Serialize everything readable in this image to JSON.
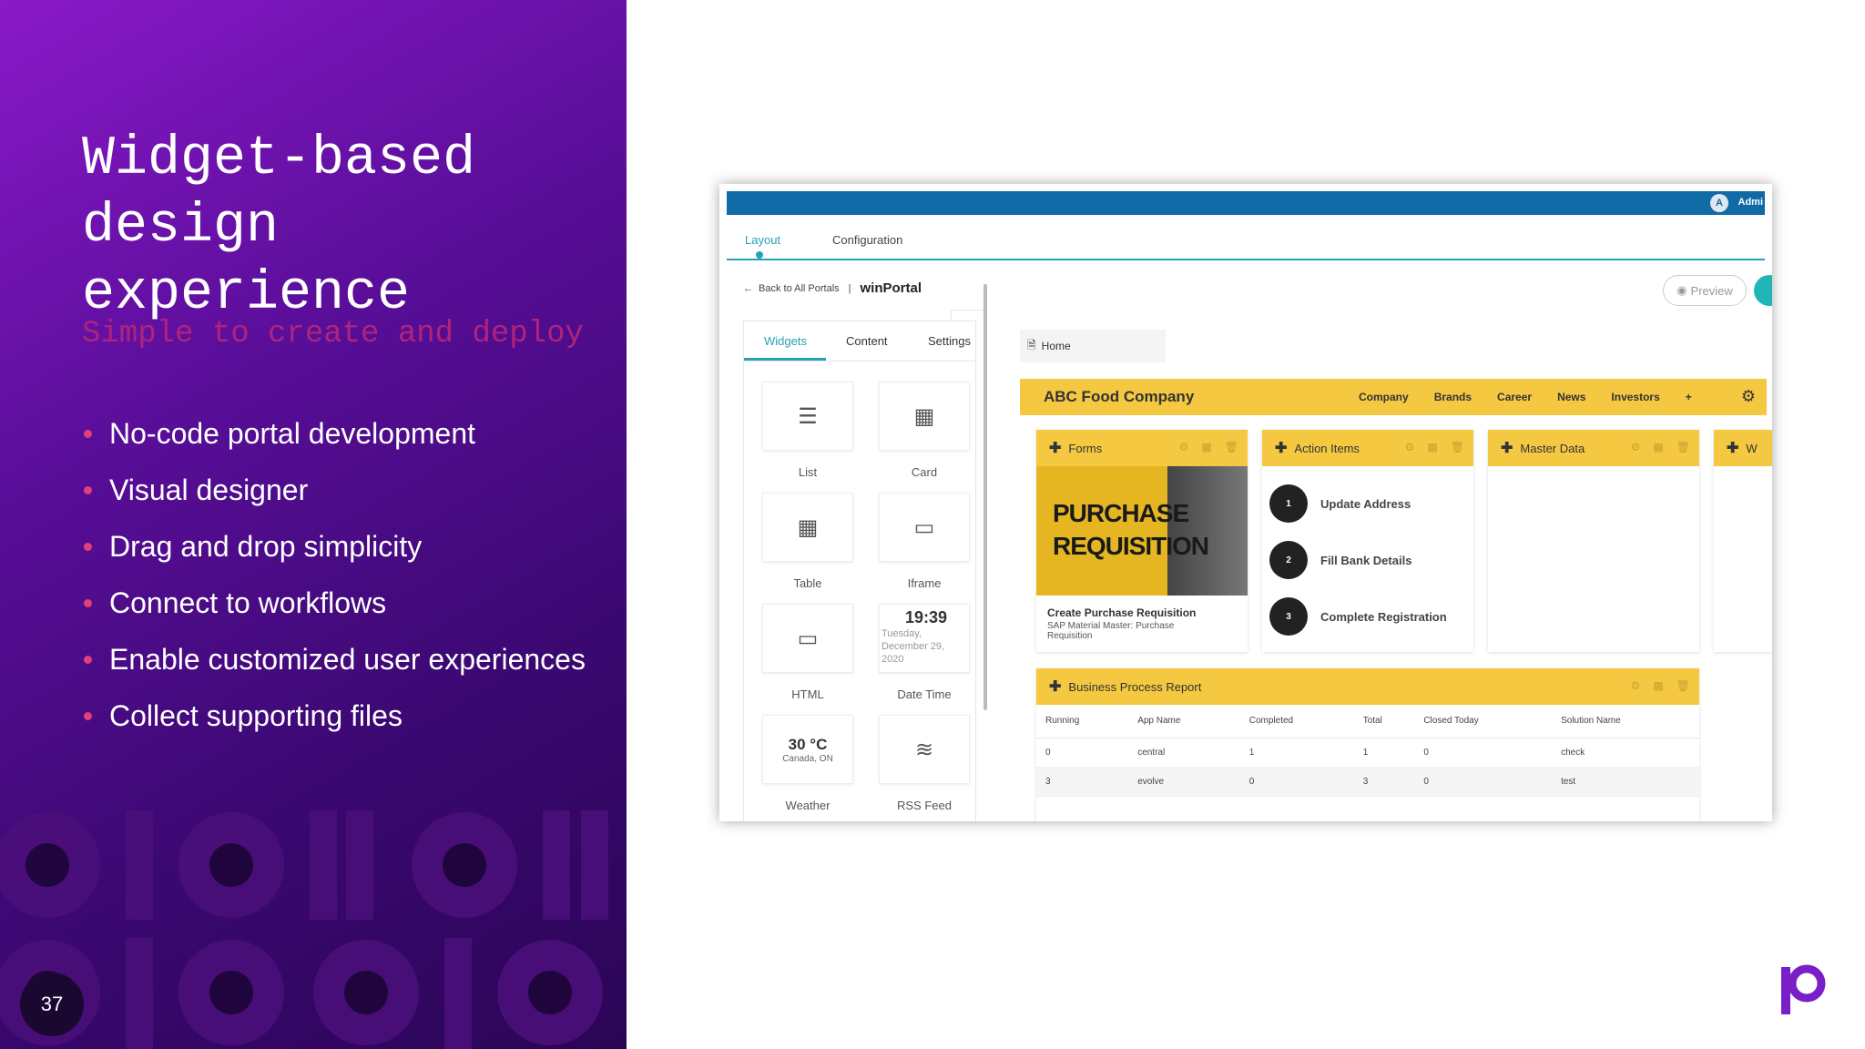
{
  "slide": {
    "title": "Widget-based design experience",
    "subtitle": "Simple to create and deploy",
    "bullets": [
      "No-code portal development",
      "Visual designer",
      "Drag and drop simplicity",
      "Connect to workflows",
      "Enable customized user experiences",
      "Collect supporting files"
    ],
    "page_number": "37"
  },
  "app": {
    "user_initial": "A",
    "user_name": "Admi",
    "main_tabs": [
      "Layout",
      "Configuration"
    ],
    "back_label": "Back to All Portals",
    "separator": "|",
    "portal_name": "winPortal",
    "preview_label": "Preview",
    "widget_tabs": [
      "Widgets",
      "Content",
      "Settings"
    ],
    "widgets": [
      {
        "label": "List",
        "icon": "list-icon"
      },
      {
        "label": "Card",
        "icon": "card-icon"
      },
      {
        "label": "Table",
        "icon": "table-icon"
      },
      {
        "label": "Iframe",
        "icon": "iframe-icon"
      },
      {
        "label": "HTML",
        "icon": "html-icon"
      },
      {
        "label": "Date Time",
        "icon": "datetime-icon"
      },
      {
        "label": "Weather",
        "icon": "weather-icon"
      },
      {
        "label": "RSS Feed",
        "icon": "rss-icon"
      }
    ],
    "datetime": {
      "time": "19:39",
      "date": "Tuesday, December 29, 2020"
    },
    "weather": {
      "temp": "30 °C",
      "location": "Canada, ON"
    },
    "page_tab": "Home",
    "company": "ABC Food Company",
    "nav": [
      "Company",
      "Brands",
      "Career",
      "News",
      "Investors",
      "+"
    ],
    "cards": {
      "forms": "Forms",
      "action_items": "Action Items",
      "master_data": "Master Data",
      "overflow": "W"
    },
    "purchase": {
      "image_text_1": "PURCHASE",
      "image_text_2": "REQUISITION",
      "title": "Create Purchase Requisition",
      "subtitle": "SAP Material Master: Purchase",
      "subtitle_2": "Requisition"
    },
    "actions": [
      {
        "num": "1",
        "label": "Update Address"
      },
      {
        "num": "2",
        "label": "Fill Bank Details"
      },
      {
        "num": "3",
        "label": "Complete Registration"
      }
    ],
    "bpr": {
      "title": "Business Process Report",
      "columns": [
        "Running",
        "App Name",
        "Completed",
        "Total",
        "Closed Today",
        "Solution Name"
      ],
      "rows": [
        [
          "0",
          "central",
          "1",
          "1",
          "0",
          "check"
        ],
        [
          "3",
          "evolve",
          "0",
          "3",
          "0",
          "test"
        ]
      ]
    }
  },
  "colors": {
    "accent": "#27a1b8",
    "topbar": "#0f6aa6",
    "yellow": "#f5c842",
    "bullet": "#e0407a",
    "subtitle": "#b0237a",
    "logo": "#7a1fc8"
  }
}
